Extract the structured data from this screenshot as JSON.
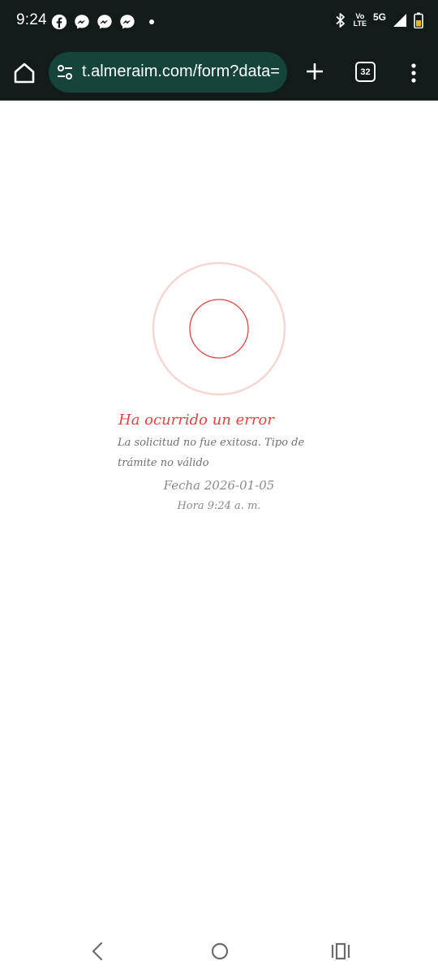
{
  "status_bar": {
    "time": "9:24",
    "notification_icons": [
      "facebook-icon",
      "messenger-icon",
      "messenger-icon",
      "messenger-icon"
    ],
    "volte_top": "Vo",
    "volte_bottom": "LTE",
    "network": "5G"
  },
  "browser": {
    "url": "t.almeraim.com/form?data=",
    "tab_count": "32"
  },
  "error": {
    "title": "Ha ocurrido un error",
    "message": "La solicitud no fue exitosa. Tipo de trámite no válido",
    "date": "Fecha 2026-01-05",
    "time": "Hora 9:24 a. m."
  },
  "colors": {
    "status_bg": "#121a1a",
    "omnibox_bg": "#15443b",
    "error_red": "#e8413d",
    "text_gray": "#707070"
  }
}
